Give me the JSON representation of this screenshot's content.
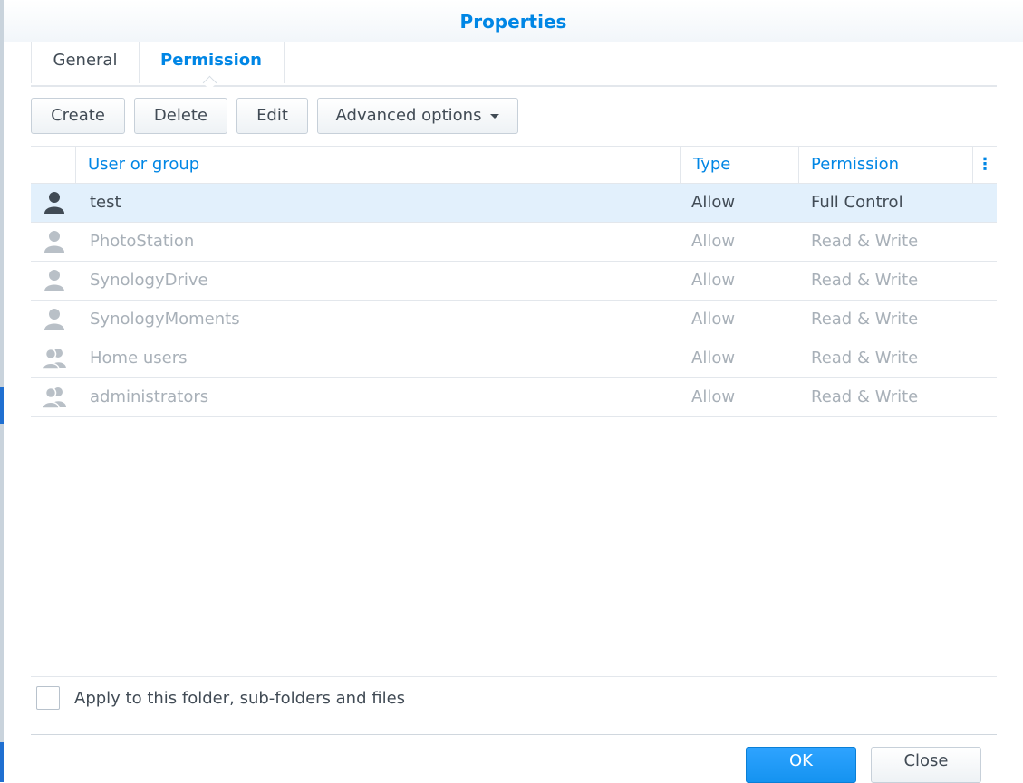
{
  "dialog": {
    "title": "Properties"
  },
  "tabs": [
    {
      "label": "General",
      "active": false
    },
    {
      "label": "Permission",
      "active": true
    }
  ],
  "toolbar": {
    "create": "Create",
    "delete": "Delete",
    "edit": "Edit",
    "advanced": "Advanced options"
  },
  "grid": {
    "columns": {
      "user": "User or group",
      "type": "Type",
      "permission": "Permission",
      "menu": "⋮"
    },
    "rows": [
      {
        "icon": "user-icon",
        "name": "test",
        "type": "Allow",
        "permission": "Full Control",
        "selected": true
      },
      {
        "icon": "user-icon",
        "name": "PhotoStation",
        "type": "Allow",
        "permission": "Read & Write",
        "selected": false
      },
      {
        "icon": "user-icon",
        "name": "SynologyDrive",
        "type": "Allow",
        "permission": "Read & Write",
        "selected": false
      },
      {
        "icon": "user-icon",
        "name": "SynologyMoments",
        "type": "Allow",
        "permission": "Read & Write",
        "selected": false
      },
      {
        "icon": "group-icon",
        "name": "Home users",
        "type": "Allow",
        "permission": "Read & Write",
        "selected": false
      },
      {
        "icon": "group-icon",
        "name": "administrators",
        "type": "Allow",
        "permission": "Read & Write",
        "selected": false
      }
    ]
  },
  "footer": {
    "apply_label": "Apply to this folder, sub-folders and files",
    "apply_checked": false,
    "ok_label": "OK",
    "close_label": "Close"
  },
  "colors": {
    "accent": "#0086e5",
    "selected_row": "#e2f0fc",
    "disabled_text": "#a8b0b8"
  }
}
